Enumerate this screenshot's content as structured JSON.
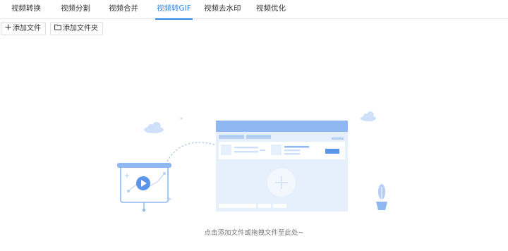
{
  "tabs": [
    {
      "label": "视频转换",
      "active": false
    },
    {
      "label": "视频分割",
      "active": false
    },
    {
      "label": "视频合并",
      "active": false
    },
    {
      "label": "视频转GIF",
      "active": true
    },
    {
      "label": "视频去水印",
      "active": false
    },
    {
      "label": "视频优化",
      "active": false
    }
  ],
  "toolbar": {
    "add_file_label": "添加文件",
    "add_file_icon": "plus-icon",
    "add_folder_label": "添加文件夹",
    "add_folder_icon": "folder-icon"
  },
  "empty_state": {
    "hint": "点击添加文件或拖拽文件至此处~"
  },
  "colors": {
    "accent": "#2f87e8",
    "illustration_blue": "#8fb8f2",
    "illustration_light": "#e6f0fd"
  }
}
